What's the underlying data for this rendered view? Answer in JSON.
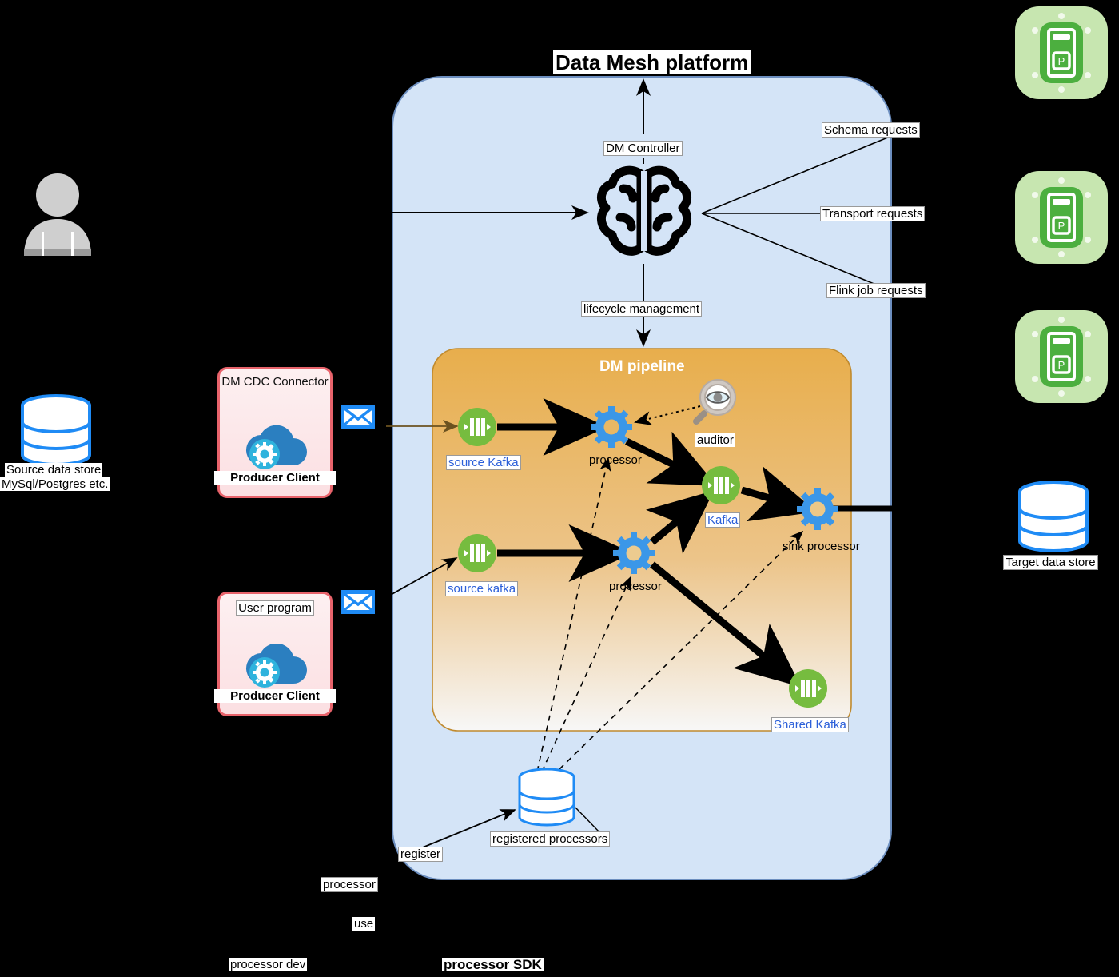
{
  "diagram": {
    "title": "Data Mesh platform",
    "platform_container": "Data Mesh platform",
    "pipeline_title": "DM pipeline"
  },
  "controller": {
    "label": "DM Controller",
    "icon": "brain-icon",
    "lifecycle_label": "lifecycle management",
    "requests": [
      {
        "label": "Schema requests"
      },
      {
        "label": "Transport requests"
      },
      {
        "label": "Flink job requests"
      }
    ]
  },
  "actors": {
    "user_icon": "user-person-icon",
    "source_store": {
      "icon": "database-cylinder-icon",
      "line1": "Source data store",
      "line2": "MySql/Postgres etc."
    },
    "target_store": {
      "icon": "database-cylinder-icon",
      "label": "Target data store"
    },
    "servers": [
      {
        "icon": "server-rack-icon"
      },
      {
        "icon": "server-rack-icon"
      },
      {
        "icon": "server-rack-icon"
      }
    ]
  },
  "producers": [
    {
      "title": "DM CDC Connector",
      "footer": "Producer Client",
      "icon": "cloud-gear-icon",
      "envelope": "envelope-icon"
    },
    {
      "title": "User program",
      "footer": "Producer Client",
      "icon": "cloud-gear-icon",
      "envelope": "envelope-icon"
    }
  ],
  "pipeline": {
    "nodes": [
      {
        "id": "source-kafka-top",
        "label": "source Kafka",
        "icon": "kafka-icon"
      },
      {
        "id": "processor-top",
        "label": "processor",
        "icon": "gear-icon"
      },
      {
        "id": "auditor",
        "label": "auditor",
        "icon": "magnifier-eye-icon"
      },
      {
        "id": "kafka-mid",
        "label": "Kafka",
        "icon": "kafka-icon"
      },
      {
        "id": "sink-processor",
        "label": "sink processor",
        "icon": "gear-icon"
      },
      {
        "id": "source-kafka-bottom",
        "label": "source kafka",
        "icon": "kafka-icon"
      },
      {
        "id": "processor-bottom",
        "label": "processor",
        "icon": "gear-icon"
      },
      {
        "id": "shared-kafka",
        "label": "Shared Kafka",
        "icon": "kafka-icon"
      }
    ]
  },
  "registry": {
    "label": "registered processors",
    "icon": "database-cylinder-icon",
    "register_label": "register"
  },
  "bottom": {
    "processor_label": "processor",
    "use_label": "use",
    "processor_dev_label": "processor dev",
    "processor_sdk_label": "processor SDK"
  },
  "colors": {
    "platform_fill": "#d4e4f7",
    "platform_stroke": "#6c8ebf",
    "pipeline_top": "#e8ae4c",
    "pipeline_bottom": "#f5f5f5",
    "kafka_green": "#76bc3f",
    "gear_blue": "#3b97e8",
    "producer_red": "#e8636b",
    "db_blue": "#1f8bf5",
    "server_green": "#4caf3f",
    "label_blue": "#2b5fd9"
  }
}
